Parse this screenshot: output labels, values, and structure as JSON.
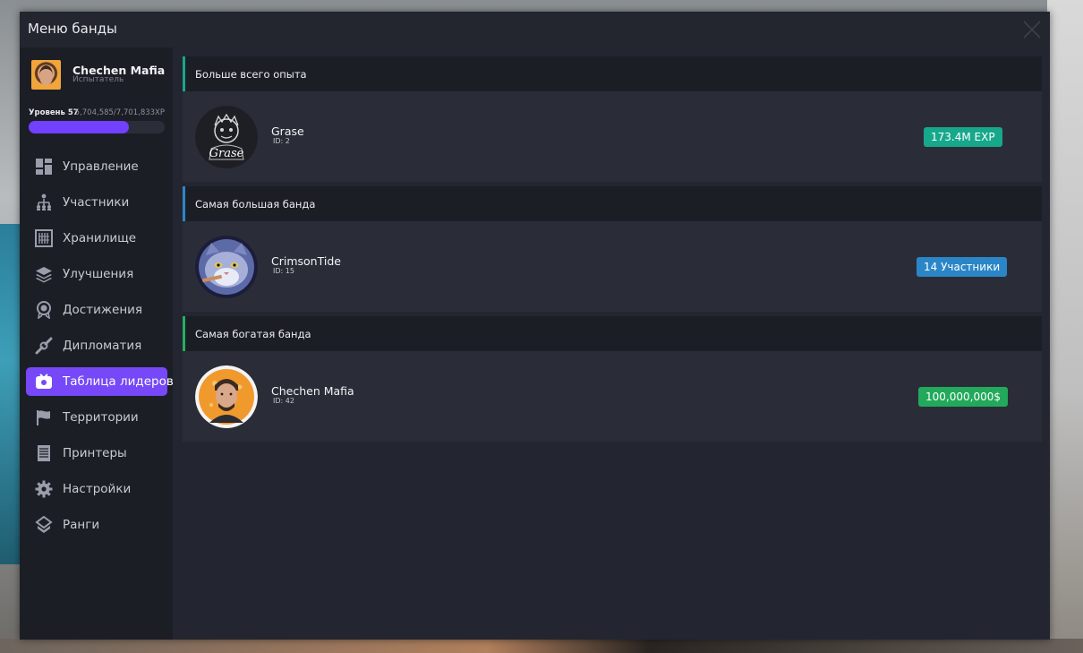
{
  "window": {
    "title": "Меню банды"
  },
  "profile": {
    "name": "Chechen Mafia",
    "role": "Испытатель",
    "level_label": "Уровень 57",
    "xp_label": "5,704,585/7,701,833XP",
    "xp_progress": 0.74
  },
  "nav": {
    "items": [
      {
        "label": "Управление",
        "icon": "dashboard-icon",
        "active": false
      },
      {
        "label": "Участники",
        "icon": "members-icon",
        "active": false
      },
      {
        "label": "Хранилище",
        "icon": "storage-icon",
        "active": false
      },
      {
        "label": "Улучшения",
        "icon": "layers-icon",
        "active": false
      },
      {
        "label": "Достижения",
        "icon": "medal-icon",
        "active": false
      },
      {
        "label": "Дипломатия",
        "icon": "handshake-icon",
        "active": false
      },
      {
        "label": "Таблица лидеров",
        "icon": "leaderboard-icon",
        "active": true
      },
      {
        "label": "Территории",
        "icon": "flag-icon",
        "active": false
      },
      {
        "label": "Принтеры",
        "icon": "printer-icon",
        "active": false
      },
      {
        "label": "Настройки",
        "icon": "gear-icon",
        "active": false
      },
      {
        "label": "Ранги",
        "icon": "rank-icon",
        "active": false
      }
    ]
  },
  "leaderboard": {
    "cards": [
      {
        "heading": "Больше всего опыта",
        "accent": "#1aa68a",
        "gang_name": "Grase",
        "gang_id": "ID: 2",
        "badge": "173.4M EXP",
        "badge_color": "#17a88c"
      },
      {
        "heading": "Самая большая банда",
        "accent": "#2d87c6",
        "gang_name": "CrimsonTide",
        "gang_id": "ID: 15",
        "badge": "14 Участники",
        "badge_color": "#2b86c7"
      },
      {
        "heading": "Самая богатая банда",
        "accent": "#25b05f",
        "gang_name": "Chechen Mafia",
        "gang_id": "ID: 42",
        "badge": "100,000,000$",
        "badge_color": "#22a95b"
      }
    ]
  }
}
